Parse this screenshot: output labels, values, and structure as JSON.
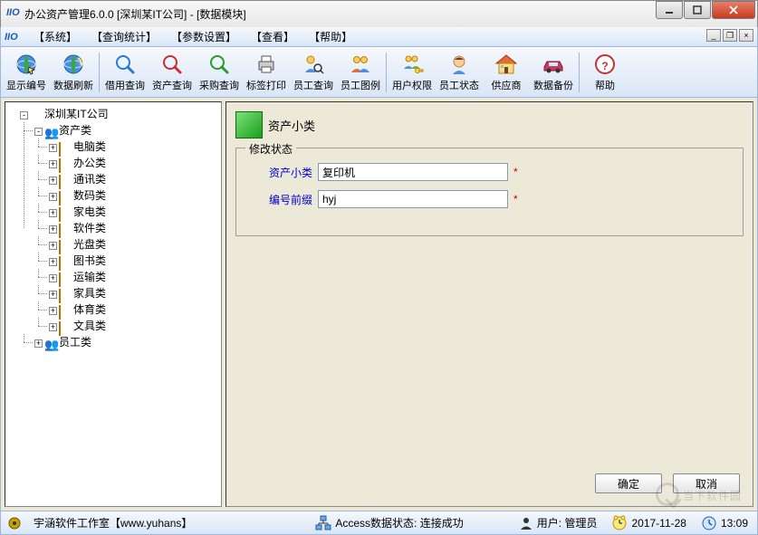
{
  "window": {
    "title": "办公资产管理6.0.0  [深圳某IT公司] - [数据模块]"
  },
  "menu": {
    "items": [
      "【系统】",
      "【查询统计】",
      "【参数设置】",
      "【查看】",
      "【帮助】"
    ]
  },
  "toolbar": {
    "items": [
      {
        "label": "显示编号",
        "icon": "globe-cursor"
      },
      {
        "label": "数据刷新",
        "icon": "globe-refresh"
      },
      {
        "sep": true
      },
      {
        "label": "借用查询",
        "icon": "magnifier-blue"
      },
      {
        "label": "资产查询",
        "icon": "magnifier-red"
      },
      {
        "label": "采购查询",
        "icon": "magnifier-green"
      },
      {
        "label": "标签打印",
        "icon": "printer"
      },
      {
        "label": "员工查询",
        "icon": "person-search"
      },
      {
        "label": "员工图例",
        "icon": "people"
      },
      {
        "sep": true
      },
      {
        "label": "用户权限",
        "icon": "users-key"
      },
      {
        "label": "员工状态",
        "icon": "person-head"
      },
      {
        "label": "供应商",
        "icon": "house"
      },
      {
        "label": "数据备份",
        "icon": "car"
      },
      {
        "sep": true
      },
      {
        "label": "帮助",
        "icon": "help"
      }
    ]
  },
  "tree": {
    "root": "深圳某IT公司",
    "assetGroup": "资产类",
    "assetItems": [
      "电脑类",
      "办公类",
      "通讯类",
      "数码类",
      "家电类",
      "软件类",
      "光盘类",
      "图书类",
      "运输类",
      "家具类",
      "体育类",
      "文具类"
    ],
    "employeeGroup": "员工类"
  },
  "panel": {
    "headerTitle": "资产小类",
    "fieldsetLegend": "修改状态",
    "fields": {
      "field1": {
        "label": "资产小类",
        "value": "复印机"
      },
      "field2": {
        "label": "编号前缀",
        "value": "hyj"
      }
    },
    "buttons": {
      "ok": "确定",
      "cancel": "取消"
    }
  },
  "status": {
    "studio": "宇涵软件工作室【www.yuhans】",
    "db": "Access数据状态: 连接成功",
    "user": "用户: 管理员",
    "date": "2017-11-28",
    "time": "13:09"
  },
  "watermark": {
    "text": "当下软件园"
  }
}
